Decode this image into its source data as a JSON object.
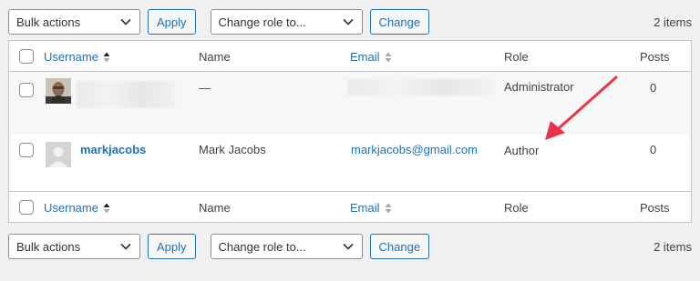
{
  "bulk_actions": {
    "label": "Bulk actions"
  },
  "apply": {
    "label": "Apply"
  },
  "change_role": {
    "label": "Change role to..."
  },
  "change": {
    "label": "Change"
  },
  "count": {
    "label": "2 items"
  },
  "columns": {
    "username": "Username",
    "name": "Name",
    "email": "Email",
    "role": "Role",
    "posts": "Posts"
  },
  "rows": [
    {
      "username": "",
      "name": "—",
      "email": "",
      "role": "Administrator",
      "posts": "0"
    },
    {
      "username": "markjacobs",
      "name": "Mark Jacobs",
      "email": "markjacobs@gmail.com",
      "role": "Author",
      "posts": "0"
    }
  ],
  "colors": {
    "accent": "#2271b1",
    "annotation_arrow": "#e8334a"
  }
}
